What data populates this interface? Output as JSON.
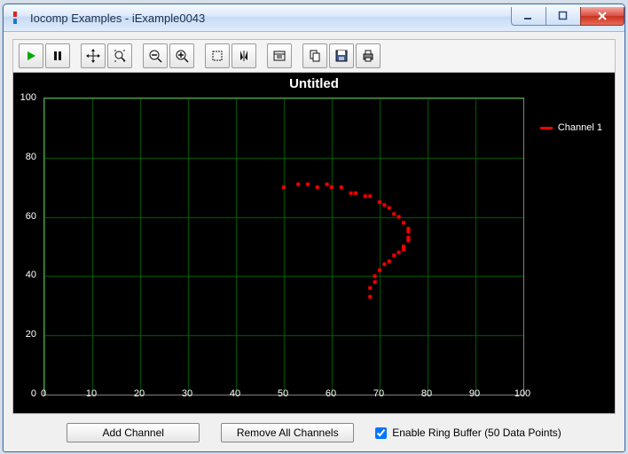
{
  "window": {
    "title": "Iocomp Examples - iExample0043"
  },
  "bottom": {
    "add_channel": "Add Channel",
    "remove_all": "Remove All Channels",
    "ring_buffer_label": "Enable Ring Buffer (50 Data Points)",
    "ring_buffer_checked": true
  },
  "chart_data": {
    "type": "scatter",
    "title": "Untitled",
    "xlabel": "",
    "ylabel": "",
    "xlim": [
      0,
      100
    ],
    "ylim": [
      0,
      100
    ],
    "x_ticks": [
      0,
      10,
      20,
      30,
      40,
      50,
      60,
      70,
      80,
      90,
      100
    ],
    "y_ticks": [
      0,
      20,
      40,
      60,
      80,
      100
    ],
    "legend_position": "right",
    "grid": true,
    "series": [
      {
        "name": "Channel 1",
        "color": "#ff0000",
        "marker": "square",
        "marker_size": 4,
        "x": [
          50,
          53,
          55,
          57,
          59,
          60,
          62,
          64,
          65,
          67,
          68,
          70,
          71,
          72,
          73,
          74,
          75,
          76,
          76,
          76,
          76,
          75,
          75,
          74,
          73,
          72,
          71,
          70,
          69,
          69,
          68,
          68
        ],
        "y": [
          70,
          71,
          71,
          70,
          71,
          70,
          70,
          68,
          68,
          67,
          67,
          65,
          64,
          63,
          61,
          60,
          58,
          56,
          55,
          53,
          52,
          50,
          49,
          48,
          47,
          45,
          44,
          42,
          40,
          38,
          36,
          33
        ]
      }
    ]
  }
}
